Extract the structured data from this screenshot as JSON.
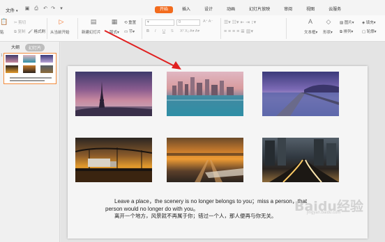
{
  "menu": {
    "file_label": "文件",
    "tabs": [
      {
        "label": "开始",
        "active": true
      },
      {
        "label": "插入"
      },
      {
        "label": "设计"
      },
      {
        "label": "动画"
      },
      {
        "label": "幻灯片放映"
      },
      {
        "label": "审阅"
      },
      {
        "label": "视图"
      },
      {
        "label": "云服务"
      }
    ]
  },
  "ribbon": {
    "paste": "贴",
    "cut": "剪切",
    "copy": "复制",
    "format_painter": "格式刷",
    "play_from_current": "从当前开始",
    "new_slide": "新建幻灯片",
    "layout": "版式",
    "section": "节",
    "reset": "重置",
    "font_size_value": "0",
    "textbox": "文本框",
    "shape": "形状",
    "picture": "图片",
    "fill": "填充",
    "arrange": "排列",
    "outline": "轮廓",
    "bold": "B",
    "italic": "I",
    "underline": "U",
    "strike": "S"
  },
  "left_pane": {
    "tab_outline": "大纲",
    "tab_slides": "幻灯片",
    "thumb_number": "1"
  },
  "slide": {
    "caption_line1": "Leave a place，the scenery is no longer belongs to you；miss a person，that",
    "caption_line2": "person would no longer do with you。",
    "caption_line3": "离开一个地方，风景就不再属于你；错过一个人，那人便再与你无关。"
  },
  "watermark": {
    "text": "Baidu经验",
    "sub": "jingyan.baidu.com"
  },
  "colors": {
    "accent": "#f26b1d",
    "arrow": "#e02020",
    "thumb_border": "#f28b3b"
  }
}
